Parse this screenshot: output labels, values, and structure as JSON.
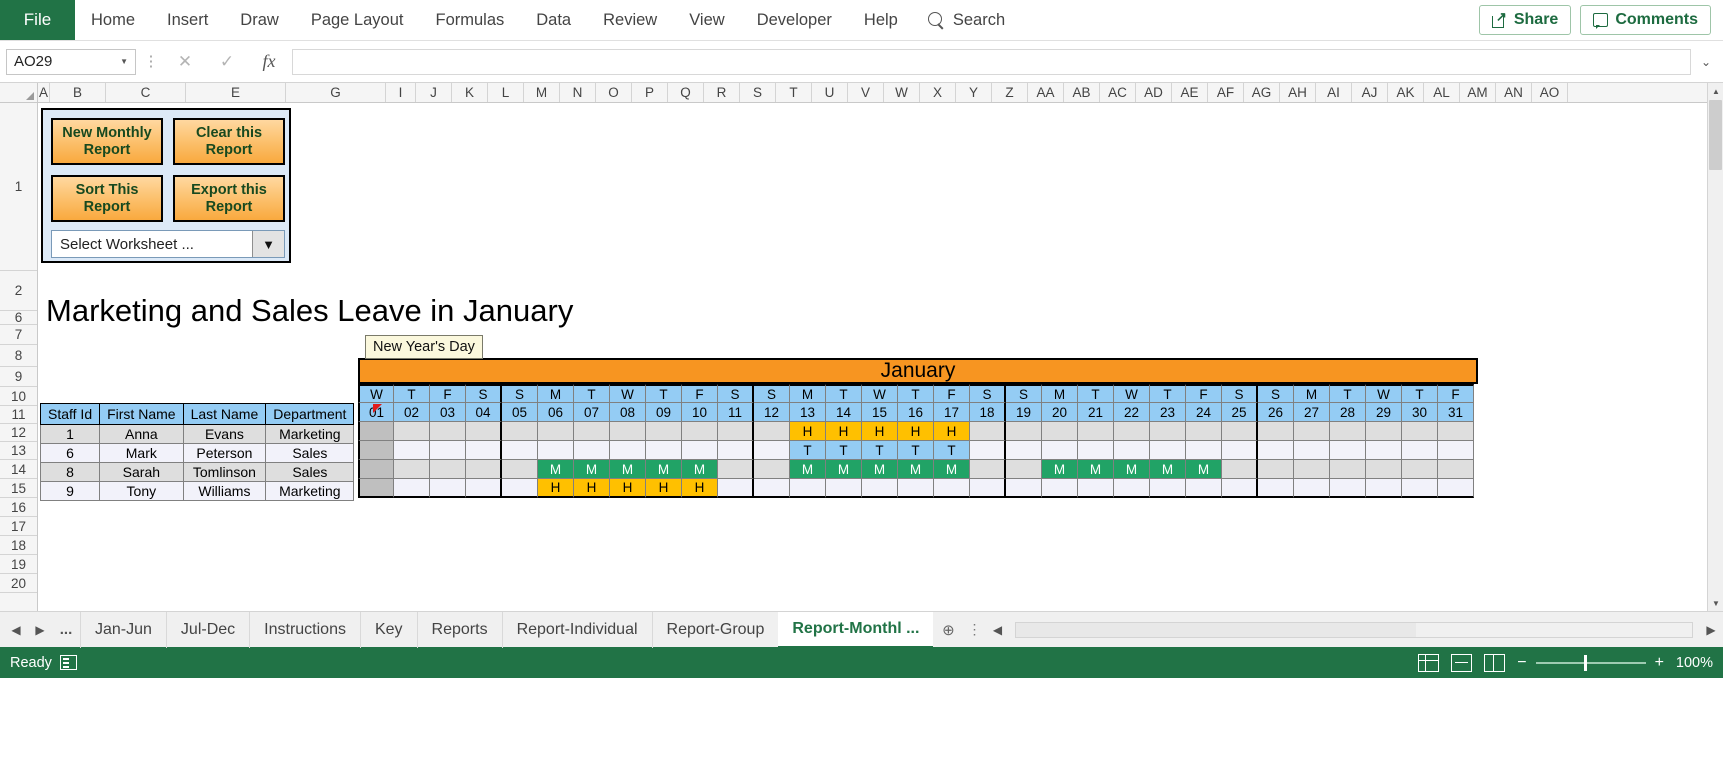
{
  "ribbon": {
    "file_label": "File",
    "tabs": [
      "Home",
      "Insert",
      "Draw",
      "Page Layout",
      "Formulas",
      "Data",
      "Review",
      "View",
      "Developer",
      "Help"
    ],
    "search_label": "Search",
    "share_label": "Share",
    "comments_label": "Comments"
  },
  "formula_bar": {
    "name_box": "AO29",
    "formula_value": "",
    "cancel_icon": "cancel-icon",
    "confirm_icon": "confirm-icon",
    "fx_icon": "fx-icon"
  },
  "columns": [
    "A",
    "B",
    "C",
    "E",
    "G",
    "I",
    "J",
    "K",
    "L",
    "M",
    "N",
    "O",
    "P",
    "Q",
    "R",
    "S",
    "T",
    "U",
    "V",
    "W",
    "X",
    "Y",
    "Z",
    "AA",
    "AB",
    "AC",
    "AD",
    "AE",
    "AF",
    "AG",
    "AH",
    "AI",
    "AJ",
    "AK",
    "AL",
    "AM",
    "AN",
    "AO"
  ],
  "rows": [
    "1",
    "2",
    "6",
    "7",
    "8",
    "9",
    "10",
    "11",
    "12",
    "13",
    "14",
    "15",
    "16",
    "17",
    "18",
    "19",
    "20"
  ],
  "macro_panel": {
    "buttons": [
      {
        "label": "New Monthly Report"
      },
      {
        "label": "Clear this Report"
      },
      {
        "label": "Sort This Report"
      },
      {
        "label": "Export this Report"
      }
    ],
    "worksheet_select": {
      "value": "Select Worksheet ...",
      "arrow_icon": "chevron-down-icon"
    }
  },
  "report": {
    "title": "Marketing and Sales Leave in January",
    "callout": "New Year's Day"
  },
  "staff_table": {
    "headers": [
      "Staff Id",
      "First Name",
      "Last Name",
      "Department"
    ],
    "rows": [
      {
        "staff_id": "1",
        "first_name": "Anna",
        "last_name": "Evans",
        "department": "Marketing"
      },
      {
        "staff_id": "6",
        "first_name": "Mark",
        "last_name": "Peterson",
        "department": "Sales"
      },
      {
        "staff_id": "8",
        "first_name": "Sarah",
        "last_name": "Tomlinson",
        "department": "Sales"
      },
      {
        "staff_id": "9",
        "first_name": "Tony",
        "last_name": "Williams",
        "department": "Marketing"
      }
    ]
  },
  "calendar": {
    "month_label": "January",
    "weekdays": [
      "W",
      "T",
      "F",
      "S",
      "S",
      "M",
      "T",
      "W",
      "T",
      "F",
      "S",
      "S",
      "M",
      "T",
      "W",
      "T",
      "F",
      "S",
      "S",
      "M",
      "T",
      "W",
      "T",
      "F",
      "S",
      "S",
      "M",
      "T",
      "W",
      "T",
      "F"
    ],
    "day_numbers": [
      "01",
      "02",
      "03",
      "04",
      "05",
      "06",
      "07",
      "08",
      "09",
      "10",
      "11",
      "12",
      "13",
      "14",
      "15",
      "16",
      "17",
      "18",
      "19",
      "20",
      "21",
      "22",
      "23",
      "24",
      "25",
      "26",
      "27",
      "28",
      "29",
      "30",
      "31"
    ],
    "week_break_after": [
      4,
      11,
      18,
      25
    ],
    "holidays": [
      1
    ],
    "leave_rows": [
      {
        "staff": "Anna Evans",
        "shade": "a",
        "codes": {
          "13": "H",
          "14": "H",
          "15": "H",
          "16": "H",
          "17": "H"
        }
      },
      {
        "staff": "Mark Peterson",
        "shade": "b",
        "codes": {
          "13": "T",
          "14": "T",
          "15": "T",
          "16": "T",
          "17": "T"
        }
      },
      {
        "staff": "Sarah Tomlinson",
        "shade": "a",
        "codes": {
          "6": "M",
          "7": "M",
          "8": "M",
          "9": "M",
          "10": "M",
          "13": "M",
          "14": "M",
          "15": "M",
          "16": "M",
          "17": "M",
          "20": "M",
          "21": "M",
          "22": "M",
          "23": "M",
          "24": "M"
        }
      },
      {
        "staff": "Tony Williams",
        "shade": "b",
        "codes": {
          "6": "H",
          "7": "H",
          "8": "H",
          "9": "H",
          "10": "H"
        }
      }
    ],
    "code_colors": {
      "H": "#FFC000",
      "T": "#94CCF4",
      "M": "#21A366",
      "holiday": "#BFBFBF"
    },
    "header_color": "#F79521",
    "dayheader_color": "#94CCF4"
  },
  "sheet_tabs": {
    "overflow_label": "...",
    "tabs": [
      "Jan-Jun",
      "Jul-Dec",
      "Instructions",
      "Key",
      "Reports",
      "Report-Individual",
      "Report-Group",
      "Report-Monthl ..."
    ],
    "active": "Report-Monthl ...",
    "add_icon": "add-sheet-icon"
  },
  "status_bar": {
    "state": "Ready",
    "zoom": "100%",
    "view_normal": "normal-view-icon",
    "view_pagelayout": "page-layout-icon",
    "view_pagebreak": "page-break-icon",
    "zoom_out": "−",
    "zoom_in": "+"
  }
}
